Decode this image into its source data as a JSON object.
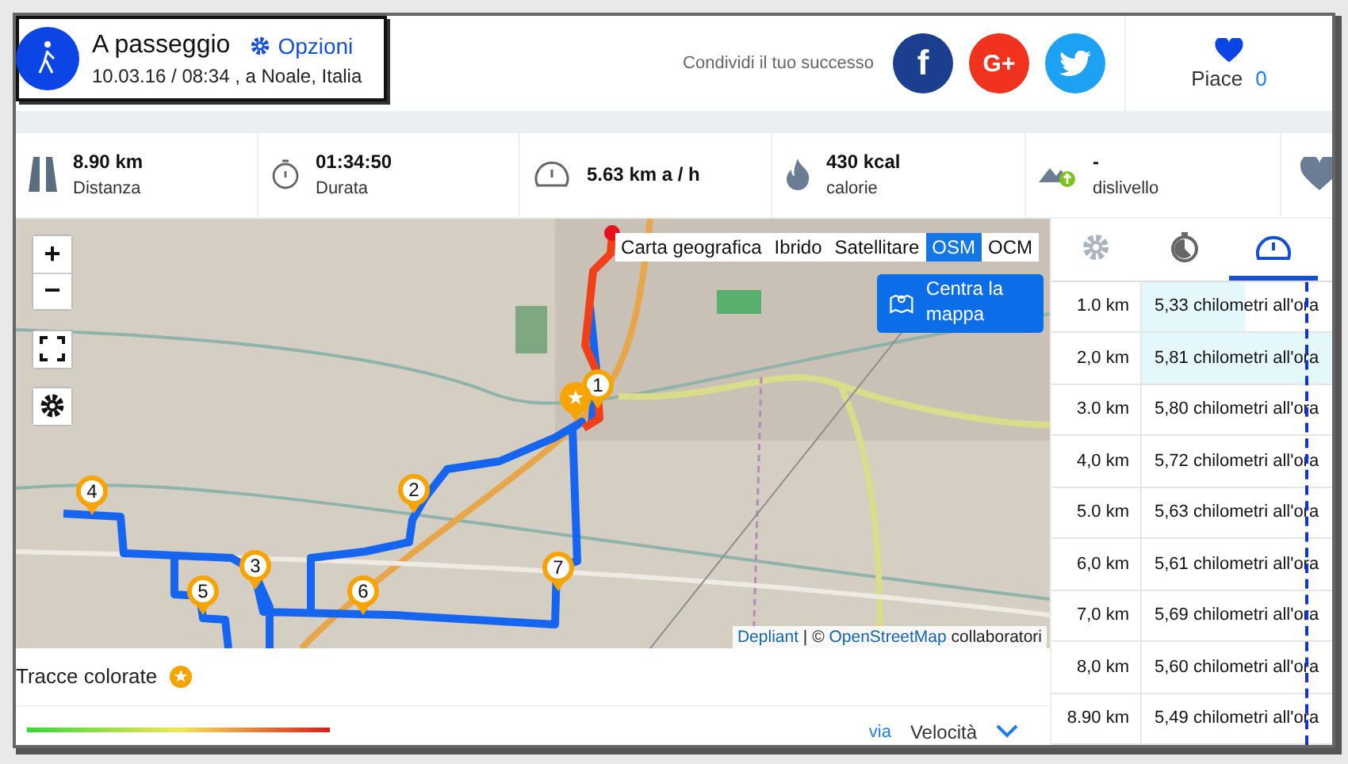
{
  "header": {
    "title": "A passeggio",
    "options_link": "Opzioni",
    "subtitle": "10.03.16 / 08:34 , a Noale, Italia"
  },
  "share": {
    "label": "Condividi il tuo successo",
    "buttons": [
      {
        "kind": "facebook",
        "glyph": "f"
      },
      {
        "kind": "google",
        "glyph": "G+"
      },
      {
        "kind": "twitter"
      }
    ]
  },
  "likes": {
    "label": "Piace",
    "count": "0"
  },
  "stats": [
    {
      "kind": "distance",
      "value": "8.90 km",
      "label": "Distanza"
    },
    {
      "kind": "duration",
      "value": "01:34:50",
      "label": "Durata"
    },
    {
      "kind": "speed",
      "value": "5.63 km a / h"
    },
    {
      "kind": "calories",
      "value": "430 kcal",
      "label": "calorie"
    },
    {
      "kind": "elevation",
      "value": "-",
      "label": "dislivello"
    },
    {
      "kind": "favorite"
    }
  ],
  "map": {
    "zoom_in": "+",
    "zoom_out": "−",
    "layers": [
      {
        "label": "Carta geografica",
        "selected": false
      },
      {
        "label": "Ibrido",
        "selected": false
      },
      {
        "label": "Satellitare",
        "selected": false
      },
      {
        "label": "OSM",
        "selected": true
      },
      {
        "label": "OCM",
        "selected": false
      }
    ],
    "center_button": "Centra la mappa",
    "attribution": {
      "link": "Depliant",
      "separator": "| ©",
      "source": "OpenStreetMap",
      "suffix": "collaboratori"
    },
    "markers": [
      {
        "kind": "number",
        "label": "1"
      },
      {
        "kind": "number",
        "label": "2"
      },
      {
        "kind": "number",
        "label": "3"
      },
      {
        "kind": "number",
        "label": "4"
      },
      {
        "kind": "number",
        "label": "5"
      },
      {
        "kind": "number",
        "label": "6"
      },
      {
        "kind": "number",
        "label": "7"
      },
      {
        "kind": "star"
      }
    ]
  },
  "legend": {
    "label": "Tracce colorate"
  },
  "footer": {
    "link": "via",
    "sort": "Velocità"
  },
  "side_tabs": [
    {
      "kind": "settings",
      "selected": false
    },
    {
      "kind": "pace",
      "selected": false
    },
    {
      "kind": "speed",
      "selected": true
    }
  ],
  "splits": [
    {
      "distance": "1.0 km",
      "speed": "5,33 chilometri all'ora",
      "level": 0.69
    },
    {
      "distance": "2,0 km",
      "speed": "5,81 chilometri all'ora",
      "level": 1
    },
    {
      "distance": "3.0 km",
      "speed": "5,80 chilometri all'ora"
    },
    {
      "distance": "4,0 km",
      "speed": "5,72 chilometri all'ora"
    },
    {
      "distance": "5.0 km",
      "speed": "5,63 chilometri all'ora"
    },
    {
      "distance": "6,0 km",
      "speed": "5,61 chilometri all'ora"
    },
    {
      "distance": "7,0 km",
      "speed": "5,69 chilometri all'ora"
    },
    {
      "distance": "8,0 km",
      "speed": "5,60 chilometri all'ora"
    },
    {
      "distance": "8.90 km",
      "speed": "5,49 chilometri all'ora"
    }
  ]
}
